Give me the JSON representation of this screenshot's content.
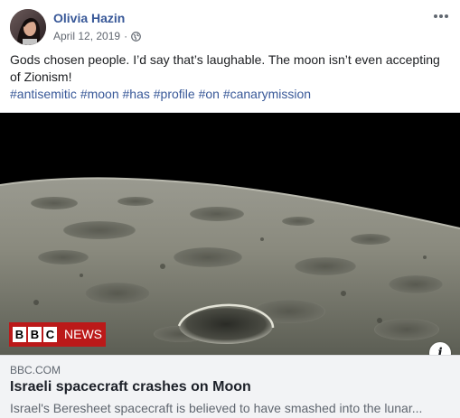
{
  "post": {
    "author": "Olivia Hazin",
    "date": "April 12, 2019",
    "separator": "·",
    "privacy_icon": "globe-icon",
    "more_icon": "more-options-icon",
    "text": "Gods chosen people. I’d say that’s laughable. The moon isn’t even accepting of Zionism!",
    "hashtags": [
      "#antisemitic",
      "#moon",
      "#has",
      "#profile",
      "#on",
      "#canarymission"
    ]
  },
  "link_preview": {
    "logo_letters": [
      "B",
      "B",
      "C"
    ],
    "logo_news": "NEWS",
    "source": "BBC.COM",
    "headline": "Israeli spacecraft crashes on Moon",
    "description": "Israel's Beresheet spacecraft is believed to have smashed into the lunar..."
  },
  "colors": {
    "link_blue": "#385898",
    "bbc_red": "#bb1919",
    "card_bg": "#f2f3f5"
  }
}
